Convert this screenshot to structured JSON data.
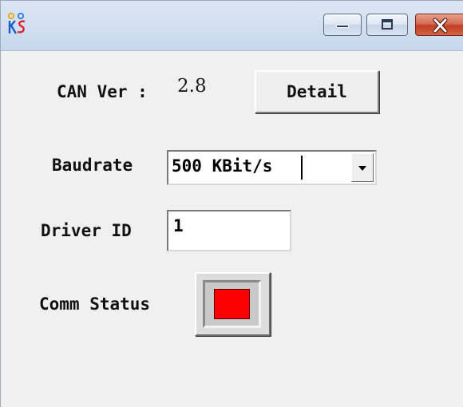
{
  "window": {
    "title": ""
  },
  "title_buttons": {
    "minimize": "minimize",
    "maximize": "maximize",
    "close": "close"
  },
  "can_version": {
    "label": "CAN Ver :",
    "value": "2.8"
  },
  "detail_button": {
    "label": "Detail"
  },
  "baudrate": {
    "label": "Baudrate",
    "selected": "500 KBit/s"
  },
  "driver_id": {
    "label": "Driver ID",
    "value": "1"
  },
  "comm_status": {
    "label": "Comm Status",
    "state_color": "#ff0000"
  },
  "colors": {
    "window_bg": "#f0f0f0",
    "titlebar": "#d2e0f1",
    "close_button": "#c23e22",
    "status_red": "#ff0000"
  },
  "icons": {
    "app": "ks-logo-icon",
    "minimize": "minimize-icon",
    "maximize": "maximize-icon",
    "close": "close-icon",
    "dropdown": "chevron-down-icon"
  }
}
